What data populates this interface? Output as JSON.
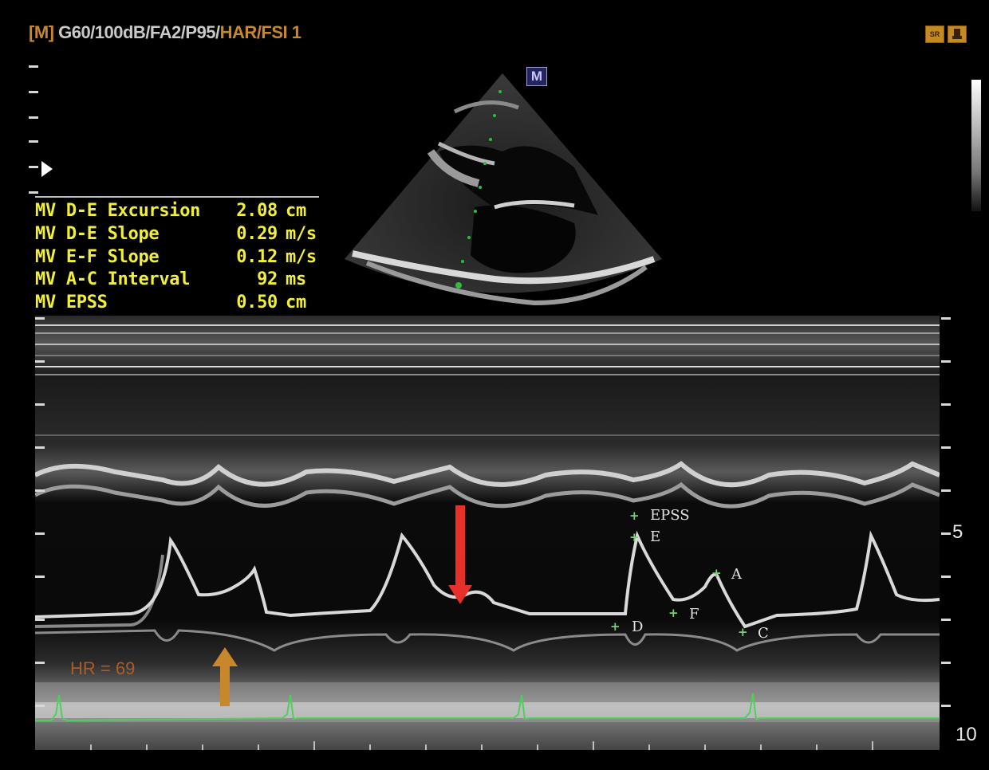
{
  "header": {
    "mode_tag": "[M]",
    "params_white": " G60/100dB/FA2/P95/",
    "params_orange": "HAR/FSI 1"
  },
  "top_icons": [
    {
      "name": "preset-icon",
      "label": "SR"
    },
    {
      "name": "probe-icon",
      "label": ""
    }
  ],
  "measurements": [
    {
      "label": "MV D-E Excursion",
      "value": "2.08",
      "unit": "cm"
    },
    {
      "label": "MV D-E Slope",
      "value": "0.29",
      "unit": "m/s"
    },
    {
      "label": "MV E-F Slope",
      "value": "0.12",
      "unit": "m/s"
    },
    {
      "label": "MV A-C Interval",
      "value": "92",
      "unit": "ms"
    },
    {
      "label": "MV EPSS",
      "value": "0.50",
      "unit": "cm"
    }
  ],
  "m_badge": "M",
  "waveform_points": {
    "epss": "EPSS",
    "e": "E",
    "a": "A",
    "f": "F",
    "d": "D",
    "c": "C"
  },
  "depth_scale": {
    "mid": "5",
    "bottom": "10"
  },
  "heart_rate": "HR = 69",
  "colors": {
    "text_yellow": "#f2ef3a",
    "accent_orange": "#c8872a",
    "ecg_green": "#4fcf5a",
    "arrow_red": "#e8302a"
  }
}
